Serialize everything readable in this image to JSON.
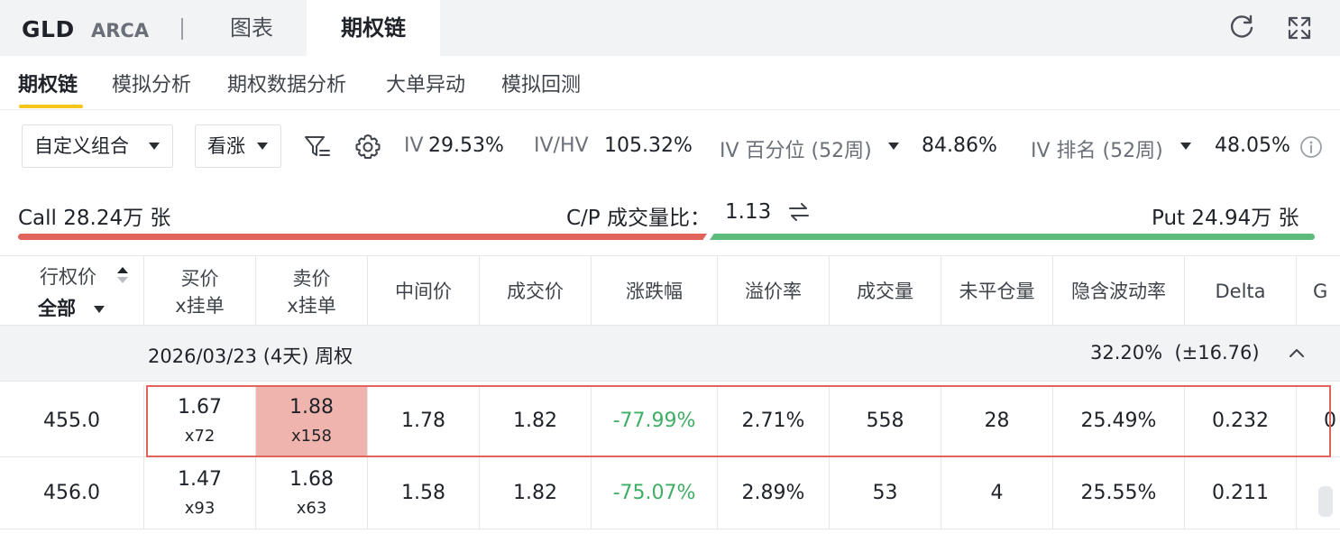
{
  "header": {
    "ticker": "GLD",
    "exchange": "ARCA",
    "tabs": [
      {
        "label": "图表",
        "active": false
      },
      {
        "label": "期权链",
        "active": true
      }
    ],
    "icons": [
      "refresh-icon",
      "fullscreen-icon"
    ]
  },
  "subnav": {
    "items": [
      {
        "label": "期权链",
        "active": true
      },
      {
        "label": "模拟分析",
        "active": false
      },
      {
        "label": "期权数据分析",
        "active": false
      },
      {
        "label": "大单异动",
        "active": false
      },
      {
        "label": "模拟回测",
        "active": false
      }
    ]
  },
  "filters": {
    "strategy": "自定义组合",
    "direction": "看涨",
    "iv_label": "IV",
    "iv_value": "29.53%",
    "ivhv_label": "IV/HV",
    "ivhv_value": "105.32%",
    "iv_pct_label": "IV 百分位 (52周)",
    "iv_pct_value": "84.86%",
    "iv_rank_label": "IV 排名 (52周)",
    "iv_rank_value": "48.05%"
  },
  "volume_bar": {
    "call_label": "Call 28.24万 张",
    "ratio_label": "C/P 成交量比：",
    "ratio_value": "1.13",
    "put_label": "Put 24.94万 张",
    "call_color": "#e0645b",
    "put_color": "#5dbb7b",
    "call_share": 0.531
  },
  "table": {
    "headers": {
      "strike": "行权价",
      "strike_filter": "全部",
      "bid_1": "买价",
      "bid_2": "x挂单",
      "ask_1": "卖价",
      "ask_2": "x挂单",
      "mid": "中间价",
      "last": "成交价",
      "change": "涨跌幅",
      "premium": "溢价率",
      "volume": "成交量",
      "open_interest": "未平仓量",
      "iv": "隐含波动率",
      "delta": "Delta",
      "gamma_partial": "G"
    },
    "group": {
      "expiry": "2026/03/23 (4天) 周权",
      "iv": "32.20%",
      "move": "(±16.76)"
    },
    "rows": [
      {
        "strike": "455.0",
        "bid": "1.67",
        "bid_size": "x72",
        "ask": "1.88",
        "ask_size": "x158",
        "mid": "1.78",
        "last": "1.82",
        "change": "-77.99%",
        "premium": "2.71%",
        "volume": "558",
        "oi": "28",
        "iv": "25.49%",
        "delta": "0.232",
        "next_partial": "0"
      },
      {
        "strike": "456.0",
        "bid": "1.47",
        "bid_size": "x93",
        "ask": "1.68",
        "ask_size": "x63",
        "mid": "1.58",
        "last": "1.82",
        "change": "-75.07%",
        "premium": "2.89%",
        "volume": "53",
        "oi": "4",
        "iv": "25.55%",
        "delta": "0.211",
        "next_partial": ""
      }
    ]
  }
}
